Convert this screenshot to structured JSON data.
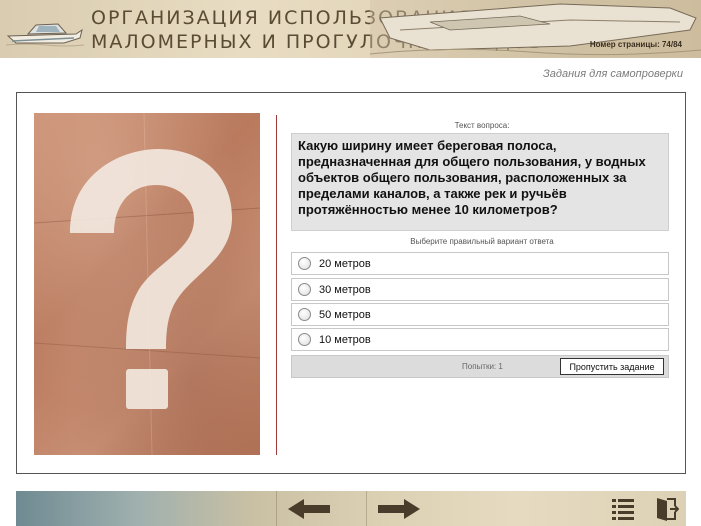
{
  "header": {
    "title_line1": "ОРГАНИЗАЦИЯ ИСПОЛЬЗОВАНИЯ",
    "title_line2": "МАЛОМЕРНЫХ И ПРОГУЛОЧНЫХ СУДОВ",
    "page_number": "Номер страницы: 74/84"
  },
  "subtitle": "Задания для самопроверки",
  "question": {
    "caption": "Текст вопроса:",
    "text": "Какую ширину имеет береговая полоса, предназначенная для общего пользования, у водных объектов общего пользования, расположенных за пределами каналов, а также рек и ручьёв протяжённостью менее 10 километров?"
  },
  "answers": {
    "caption": "Выберите правильный вариант ответа",
    "options": [
      "20 метров",
      "30 метров",
      "50 метров",
      "10 метров"
    ]
  },
  "status": {
    "attempts": "Попытки: 1",
    "skip_label": "Пропустить задание"
  },
  "icons": {
    "prev": "arrow-left-icon",
    "next": "arrow-right-icon",
    "menu": "list-icon",
    "exit": "exit-door-icon",
    "question_image": "question-mark-icon"
  },
  "colors": {
    "accent_line": "#9c3a3a",
    "question_bg": "#e4e4e4",
    "paper": "#c98d70"
  }
}
